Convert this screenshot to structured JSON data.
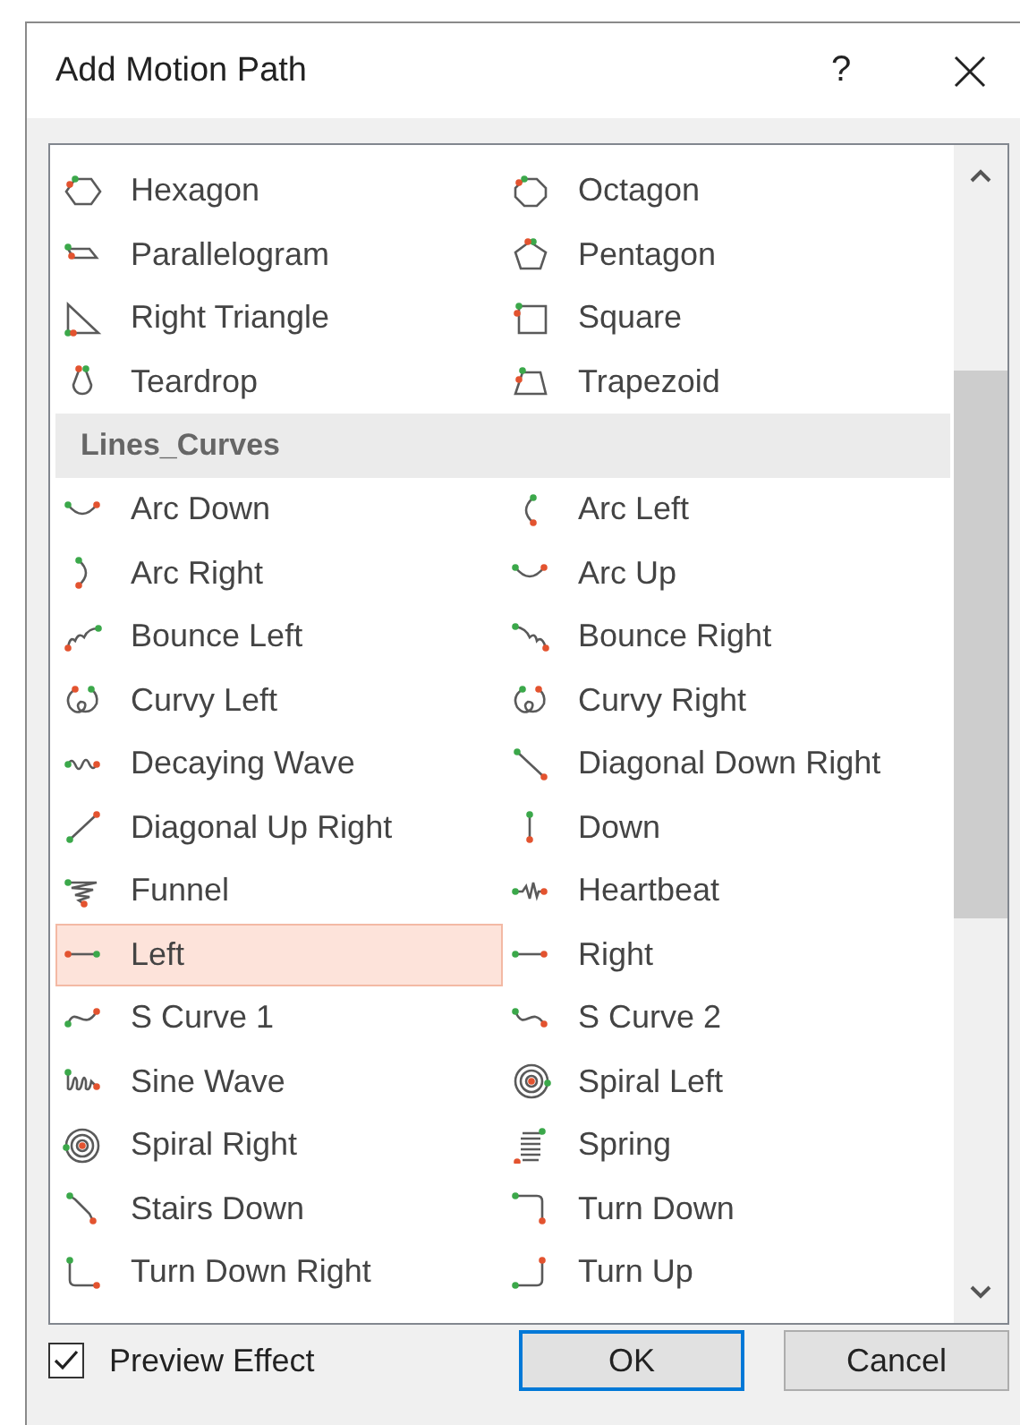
{
  "window": {
    "title": "Add Motion Path",
    "help": "?"
  },
  "list": {
    "groups": [
      {
        "items": [
          {
            "label": "Hexagon",
            "selected": false
          },
          {
            "label": "Octagon",
            "selected": false
          },
          {
            "label": "Parallelogram",
            "selected": false
          },
          {
            "label": "Pentagon",
            "selected": false
          },
          {
            "label": "Right Triangle",
            "selected": false
          },
          {
            "label": "Square",
            "selected": false
          },
          {
            "label": "Teardrop",
            "selected": false
          },
          {
            "label": "Trapezoid",
            "selected": false
          }
        ]
      },
      {
        "heading": "Lines_Curves",
        "items": [
          {
            "label": "Arc Down",
            "selected": false
          },
          {
            "label": "Arc Left",
            "selected": false
          },
          {
            "label": "Arc Right",
            "selected": false
          },
          {
            "label": "Arc Up",
            "selected": false
          },
          {
            "label": "Bounce Left",
            "selected": false
          },
          {
            "label": "Bounce Right",
            "selected": false
          },
          {
            "label": "Curvy Left",
            "selected": false
          },
          {
            "label": "Curvy Right",
            "selected": false
          },
          {
            "label": "Decaying Wave",
            "selected": false
          },
          {
            "label": "Diagonal Down Right",
            "selected": false
          },
          {
            "label": "Diagonal Up Right",
            "selected": false
          },
          {
            "label": "Down",
            "selected": false
          },
          {
            "label": "Funnel",
            "selected": false
          },
          {
            "label": "Heartbeat",
            "selected": false
          },
          {
            "label": "Left",
            "selected": true
          },
          {
            "label": "Right",
            "selected": false
          },
          {
            "label": "S Curve 1",
            "selected": false
          },
          {
            "label": "S Curve 2",
            "selected": false
          },
          {
            "label": "Sine Wave",
            "selected": false
          },
          {
            "label": "Spiral Left",
            "selected": false
          },
          {
            "label": "Spiral Right",
            "selected": false
          },
          {
            "label": "Spring",
            "selected": false
          },
          {
            "label": "Stairs Down",
            "selected": false
          },
          {
            "label": "Turn Down",
            "selected": false
          },
          {
            "label": "Turn Down Right",
            "selected": false
          },
          {
            "label": "Turn Up",
            "selected": false
          }
        ]
      }
    ]
  },
  "preview": {
    "label": "Preview Effect",
    "checked": true
  },
  "buttons": [
    {
      "label": "OK",
      "default": true
    },
    {
      "label": "Cancel",
      "default": false
    }
  ]
}
